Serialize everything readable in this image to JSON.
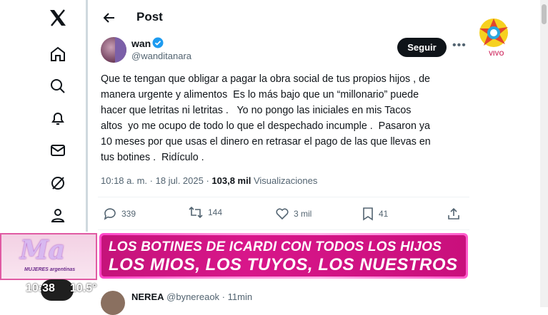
{
  "post": {
    "header_title": "Post",
    "author_name": "wan",
    "author_handle": "@wanditanara",
    "follow_label": "Seguir",
    "text": "Que te tengan que obligar a pagar la obra social de tus propios hijos , de\nmanera urgente y alimentos  Es lo más bajo que un “millonario” puede\nhacer que letritas ni letritas .   Yo no pongo las iniciales en mis Tacos\naltos  yo me ocupo de todo lo que el despechado incumple .  Pasaron ya\n10 meses por que usas el dinero en retrasar el pago de las que llevas en\ntus botines .  Ridículo .",
    "time": "10:18 a. m.",
    "date": "18 jul. 2025",
    "views_count": "103,8 mil",
    "views_label": "Visualizaciones",
    "replies": "339",
    "reposts": "144",
    "likes": "3 mil",
    "bookmarks": "41"
  },
  "reply": {
    "name": "NEREA",
    "handle": "@bynereaok",
    "time": "11min"
  },
  "overlay": {
    "channel_status": "VIVO",
    "show_logo": "Ma",
    "show_sub": "MUJERES argentinas",
    "headline_1": "LOS BOTINES DE ICARDI CON TODOS LOS HIJOS",
    "headline_2": "LOS MIOS, LOS TUYOS, LOS NUESTROS",
    "clock": "10:38",
    "temperature": "10.5°"
  },
  "colors": {
    "accent": "#1d9bf0",
    "banner": "#d8168a"
  }
}
